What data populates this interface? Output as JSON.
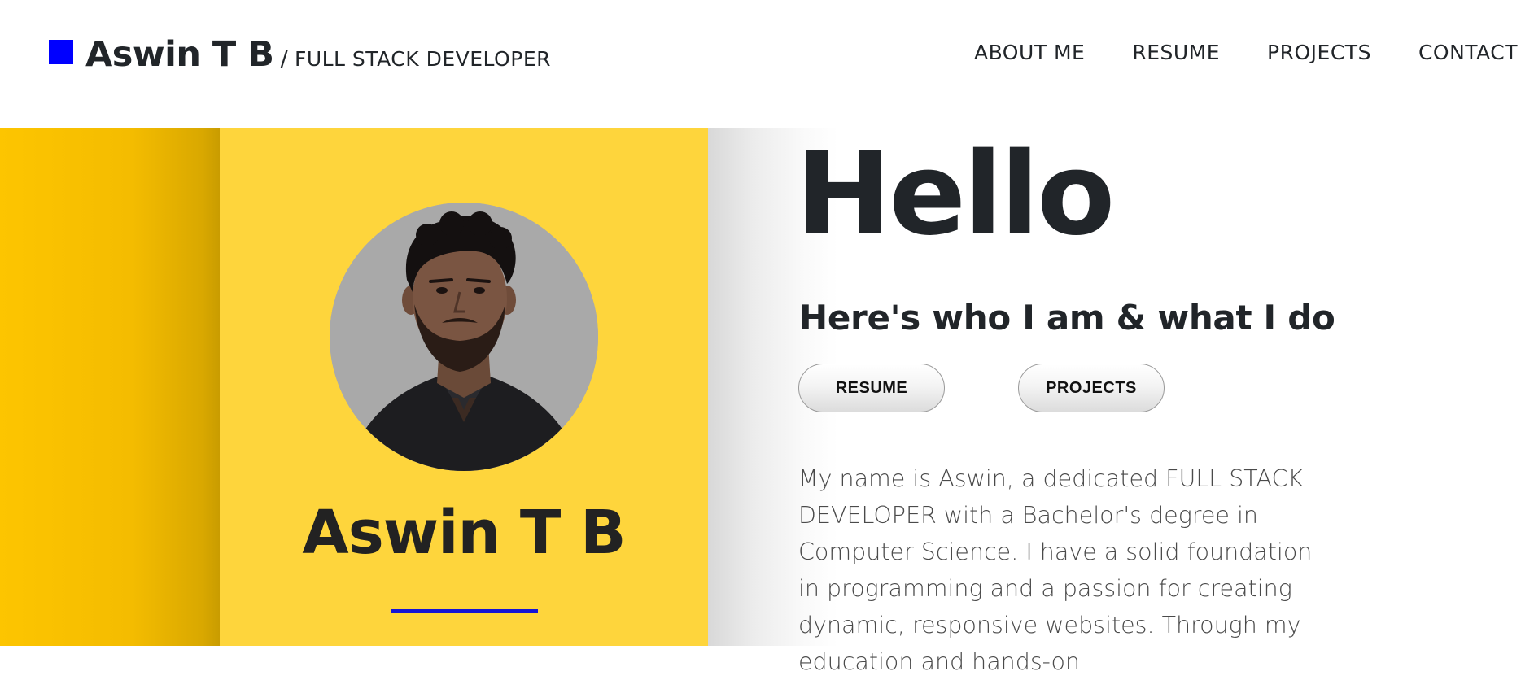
{
  "header": {
    "brand_name": "Aswin T B",
    "brand_separator": "/",
    "brand_role": "FULL STACK DEVELOPER",
    "nav": [
      {
        "label": "ABOUT ME"
      },
      {
        "label": "RESUME"
      },
      {
        "label": "PROJECTS"
      },
      {
        "label": "CONTACT"
      }
    ]
  },
  "profile": {
    "name": "Aswin T B",
    "avatar_icon": "profile-photo"
  },
  "intro": {
    "greeting": "Hello",
    "subtitle": "Here's who I am & what I do",
    "buttons": {
      "resume": "RESUME",
      "projects": "PROJECTS"
    },
    "bio": "My name is Aswin, a dedicated FULL STACK DEVELOPER with a Bachelor's degree in Computer Science. I have a solid foundation in programming and a passion for creating dynamic, responsive websites. Through my education and hands-on"
  },
  "colors": {
    "brand_square": "#0000ff",
    "card_yellow": "#fed53c",
    "strip_yellow": "#fdc500",
    "underline_blue": "#1515d6",
    "text_dark": "#212529"
  }
}
